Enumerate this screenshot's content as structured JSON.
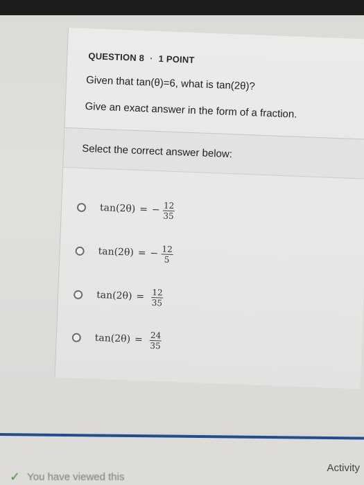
{
  "question": {
    "number_label": "QUESTION 8",
    "separator": "·",
    "points_label": "1 POINT",
    "text": "Given that tan(θ)=6, what is tan(2θ)?",
    "instruction": "Give an exact answer in the form of a fraction."
  },
  "answers": {
    "prompt": "Select the correct answer below:",
    "options": [
      {
        "lhs": "tan(2θ)",
        "eq": "=",
        "sign": "−",
        "num": "12",
        "den": "35"
      },
      {
        "lhs": "tan(2θ)",
        "eq": "=",
        "sign": "−",
        "num": "12",
        "den": "5"
      },
      {
        "lhs": "tan(2θ)",
        "eq": "=",
        "sign": "",
        "num": "12",
        "den": "35"
      },
      {
        "lhs": "tan(2θ)",
        "eq": "=",
        "sign": "",
        "num": "24",
        "den": "35"
      }
    ]
  },
  "footer": {
    "activity_label": "Activity",
    "viewed_text": "You have viewed this"
  },
  "colors": {
    "accent_rule": "#1f4f8f",
    "check": "#3f8a3f"
  }
}
